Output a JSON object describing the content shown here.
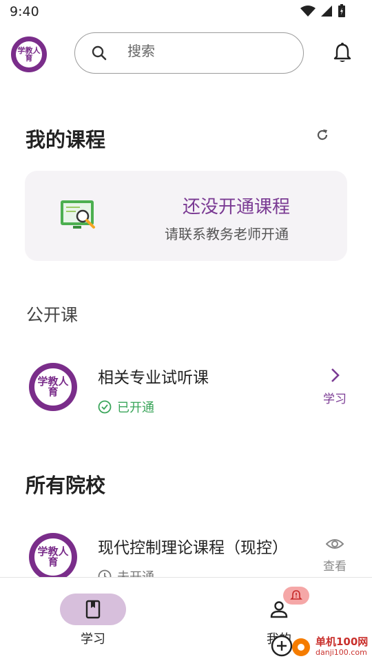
{
  "status_bar": {
    "time": "9:40"
  },
  "header": {
    "logo_text": "学教人育",
    "search_placeholder": "搜索"
  },
  "my_courses": {
    "title": "我的课程",
    "empty_title": "还没开通课程",
    "empty_subtitle": "请联系教务老师开通"
  },
  "public_courses": {
    "title": "公开课",
    "items": [
      {
        "name": "相关专业试听课",
        "status": "已开通",
        "action": "学习",
        "logo_text": "学教人育"
      }
    ]
  },
  "all_schools": {
    "title": "所有院校",
    "items": [
      {
        "name": "现代控制理论课程（现控）",
        "status": "未开通",
        "action": "查看",
        "logo_text": "学教人育"
      }
    ]
  },
  "bottom_nav": {
    "items": [
      {
        "label": "学习",
        "icon": "book-icon",
        "active": true
      },
      {
        "label": "我的",
        "icon": "person-icon",
        "active": false
      }
    ]
  },
  "watermark": {
    "text": "单机100网",
    "sub": "danji100.com"
  },
  "colors": {
    "accent": "#7a3a93",
    "success": "#3aa55a",
    "nav_pill": "#d7bfdc",
    "card_bg": "#f5f3f6"
  }
}
